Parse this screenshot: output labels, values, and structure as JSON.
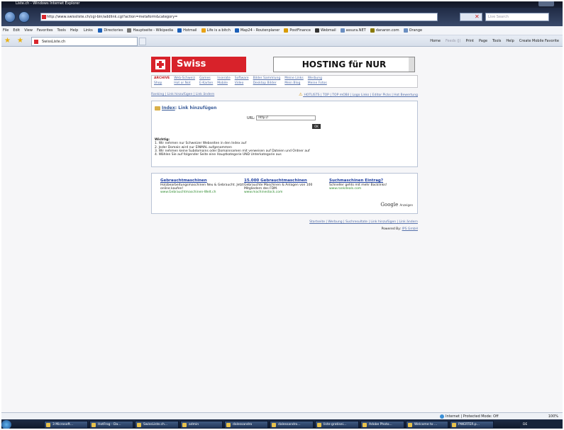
{
  "window": {
    "title": "Liste.ch - Windows Internet Explorer"
  },
  "address_bar": {
    "url": "http://www.swissliste.ch/cgi-bin/addlink.cgi?action=metaform&category=",
    "search_placeholder": "Live Search"
  },
  "menu": {
    "items": [
      "File",
      "Edit",
      "View",
      "Favorites",
      "Tools",
      "Help"
    ],
    "links_label": "Links",
    "links": [
      {
        "label": "Directories",
        "color": "#1b5fb8"
      },
      {
        "label": "Hauptseite - Wikipedia",
        "color": "#777777"
      },
      {
        "label": "Hotmail",
        "color": "#1b5fb8"
      },
      {
        "label": "Life is a bitch",
        "color": "#e8a317"
      },
      {
        "label": "Map24 - Routenplaner",
        "color": "#1b5fb8"
      },
      {
        "label": "PostFinance",
        "color": "#d89b00"
      },
      {
        "label": "Webmail",
        "color": "#333333"
      },
      {
        "label": "assura.NET",
        "color": "#6b8fc2"
      },
      {
        "label": "danaron.com",
        "color": "#8a7a00"
      },
      {
        "label": "Orange",
        "color": "#6b8fc2"
      }
    ]
  },
  "tabs": {
    "active": "SwissListe.ch"
  },
  "command_bar": {
    "items": [
      "Home",
      "Feeds (J)",
      "Print",
      "Page",
      "Tools",
      "Help",
      "Create Mobile Favorite"
    ]
  },
  "site": {
    "logo_text": "Swiss Liste.ch",
    "banner_text": "HOSTING für NUR",
    "categories": [
      [
        "ARCHIVE",
        "Web-Schweiz",
        "Games",
        "Inserate",
        "Software",
        "Bilder Sammlung",
        "Meine Links",
        "Werbung"
      ],
      [
        "Shop",
        "Hot or Not",
        "E-Karten",
        "Mobile",
        "Video",
        "Desktop Bilder",
        "Mein Blog",
        "Meine Fotos"
      ]
    ],
    "subnav_left": "Ranking | Link hinzufügen | Link ändern",
    "subnav_right": "HOTLISTS | TOP | TOP mOBil | Logo Links | Editor Picks | Hot Bewertung",
    "form": {
      "breadcrumb_index": "Index",
      "breadcrumb_rest": ": Link hinzufügen",
      "url_label": "URL:",
      "url_value": "http://",
      "ok": "OK",
      "wichtig_title": "Wichtig:",
      "rules": [
        "1. Wir nehmen nur Schweizer Webseiten in den Index auf",
        "2. Jeder Domain wird nur EINMAL aufgenommen",
        "3. Wir nehmen keine Subdomains oder Domainnamen mit verweisen auf Dateien und Ordner auf",
        "4. Wählen Sie auf folgender Seite eine Hauptkategorie UND Unterkategorie aus"
      ]
    },
    "ads": [
      {
        "title": "Gebrauchtmaschinen",
        "text": "Holzbearbeitungsmaschinen Neu & Gebraucht. Jetzt online kaufen!",
        "url": "www.Gebrauchtmaschinen-Welt.ch"
      },
      {
        "title": "15.000 Gebrauchtmaschinen",
        "text": "Gebrauchte Maschinen & Anlagen von 100 Mitgliedern des FDM.",
        "url": "www.machinestock.com"
      },
      {
        "title": "Suchmaschinen Eintrag?",
        "text": "Schneller gehts mit mehr Backlinks!",
        "url": "www.rankdeals.com"
      }
    ],
    "google_ads": "Google",
    "google_ads_suffix": "Anzeigen",
    "footer_links": "Startseite | Werbung | Suchresultate | Link hinzufügen | Link ändern",
    "powered_label": "Powered By:",
    "powered_by": "IPS GmbH"
  },
  "status_bar": {
    "zone": "Internet | Protected Mode: Off",
    "zoom": "100%"
  },
  "taskbar": {
    "tasks": [
      "3 Microsoft...",
      "HotFrog - Da...",
      "SwissListe.ch...",
      "admin",
      "dalessandro",
      "dalessandro...",
      "liste-gratisei...",
      "Adobe Photo...",
      "Welcome to ...",
      "PWERTER.p..."
    ],
    "language": "DE"
  }
}
